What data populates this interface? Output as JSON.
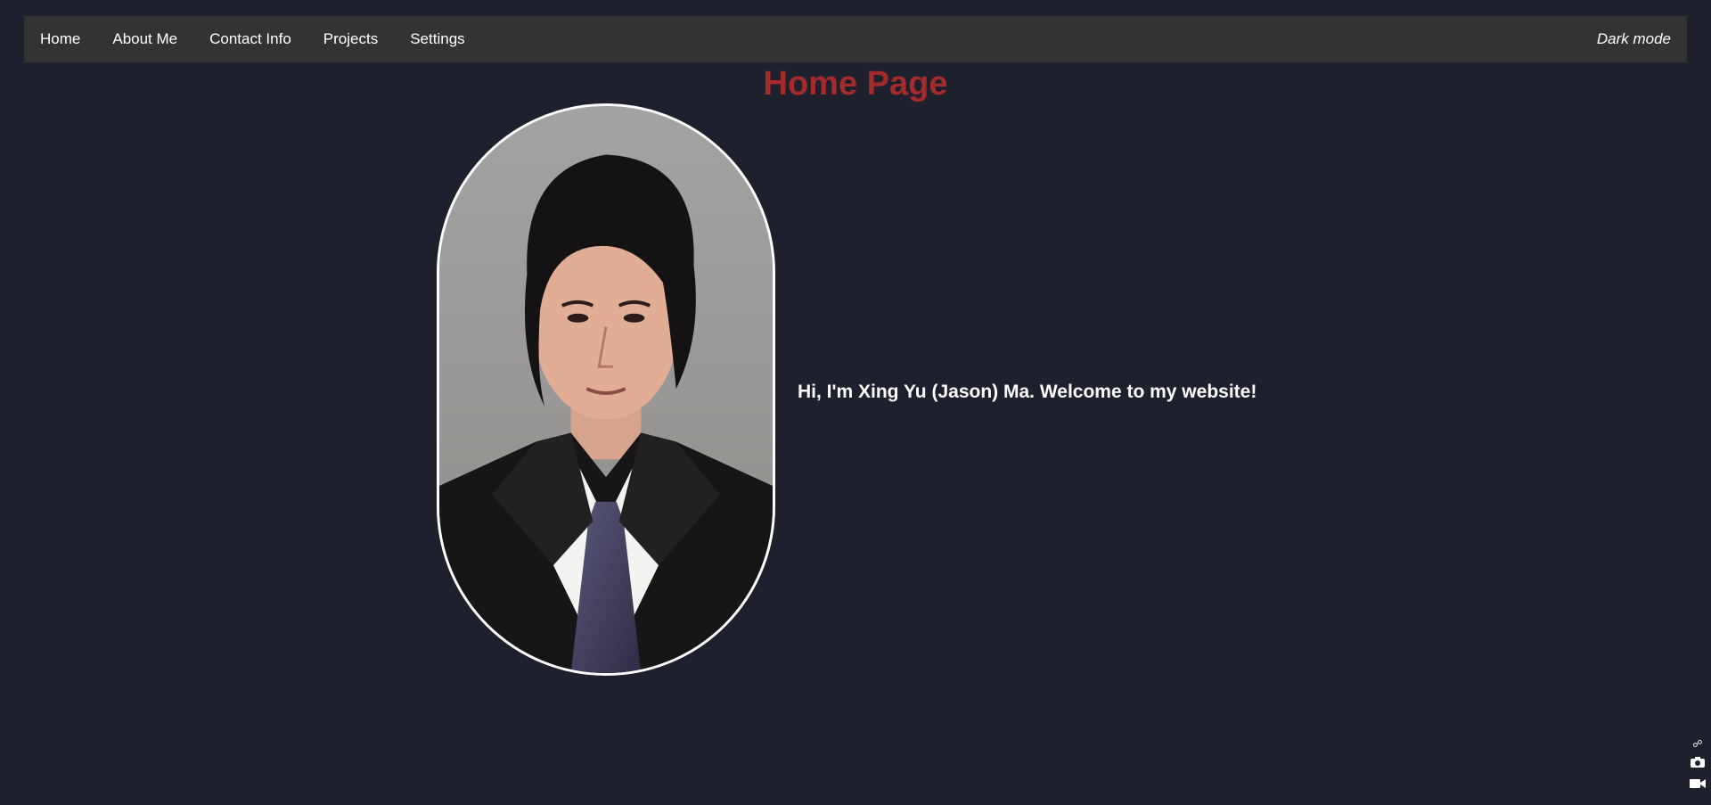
{
  "nav": {
    "items": [
      {
        "label": "Home"
      },
      {
        "label": "About Me"
      },
      {
        "label": "Contact Info"
      },
      {
        "label": "Projects"
      },
      {
        "label": "Settings"
      }
    ],
    "dark_mode_label": "Dark mode"
  },
  "main": {
    "title": "Home Page",
    "welcome_text": "Hi, I'm Xing Yu (Jason) Ma. Welcome to my website!"
  },
  "colors": {
    "background": "#1e202e",
    "navbar": "#333333",
    "title": "#a52a2a"
  },
  "icons": [
    "link-icon",
    "camera-icon",
    "video-icon"
  ]
}
